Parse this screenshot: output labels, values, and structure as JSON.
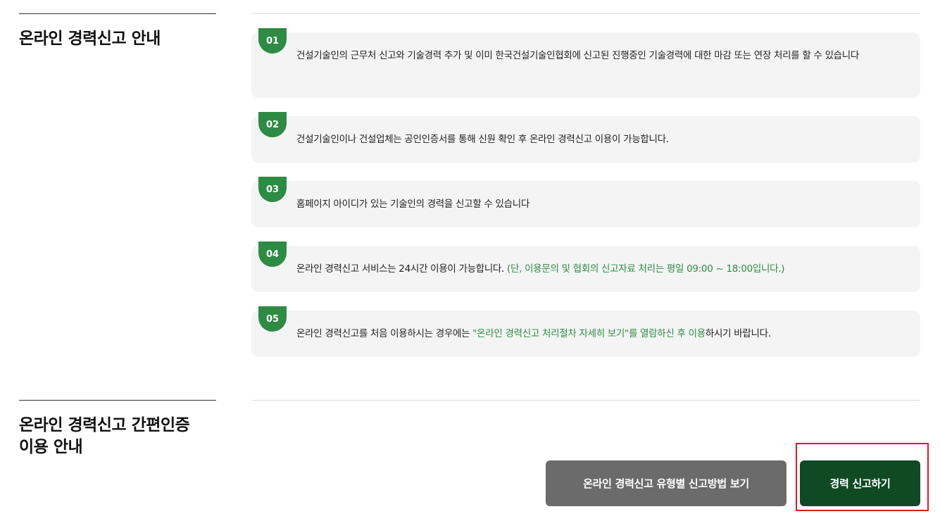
{
  "section1": {
    "title": "온라인 경력신고 안내",
    "notices": [
      {
        "num": "01",
        "text": "건설기술인의 근무처 신고와 기술경력 추가 및 이미 한국건설기술인협회에 신고된 진행중인 기술경력에 대한 마감 또는 연장 처리를 할 수 있습니다"
      },
      {
        "num": "02",
        "text": "건설기술인이나 건설업체는 공인인증서를 통해 신원 확인 후 온라인 경력신고 이용이 가능합니다."
      },
      {
        "num": "03",
        "text": "홈페이지 아이디가 있는 기술인의 경력을 신고할 수 있습니다"
      },
      {
        "num": "04",
        "text": "온라인 경력신고 서비스는 24시간 이용이 가능합니다. ",
        "highlight": "(단, 이용문의 및 협회의 신고자료 처리는 평일 09:00 ~ 18:00입니다.)"
      },
      {
        "num": "05",
        "text_before": "온라인 경력신고를 처음 이용하시는 경우에는 ",
        "highlight": "\"온라인 경력신고 처리절차 자세히 보기\"를 열람하신 후 이용",
        "text_after": "하시기 바랍니다."
      }
    ]
  },
  "section2": {
    "title_line1": "온라인 경력신고 간편인증",
    "title_line2": "이용 안내"
  },
  "buttons": {
    "guide_label": "온라인 경력신고 유형별 신고방법 보기",
    "report_label": "경력 신고하기"
  },
  "colors": {
    "accent_green": "#2e8b44",
    "dark_green": "#0f4a25",
    "gray_button": "#6b6b6b",
    "highlight_red": "#e01b1b"
  }
}
